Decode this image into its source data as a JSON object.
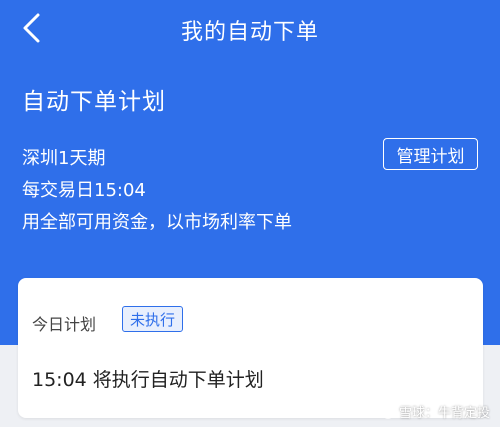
{
  "header": {
    "title": "我的自动下单"
  },
  "plan": {
    "heading": "自动下单计划",
    "product": "深圳1天期",
    "schedule": "每交易日15:04",
    "method": "用全部可用资金，以市场利率下单",
    "manage_label": "管理计划"
  },
  "today": {
    "label": "今日计划",
    "status": "未执行",
    "message": "15:04 将执行自动下单计划"
  },
  "watermark": "雪球：牛背定投",
  "colors": {
    "primary": "#2f6fea",
    "background": "#eef0f4"
  }
}
